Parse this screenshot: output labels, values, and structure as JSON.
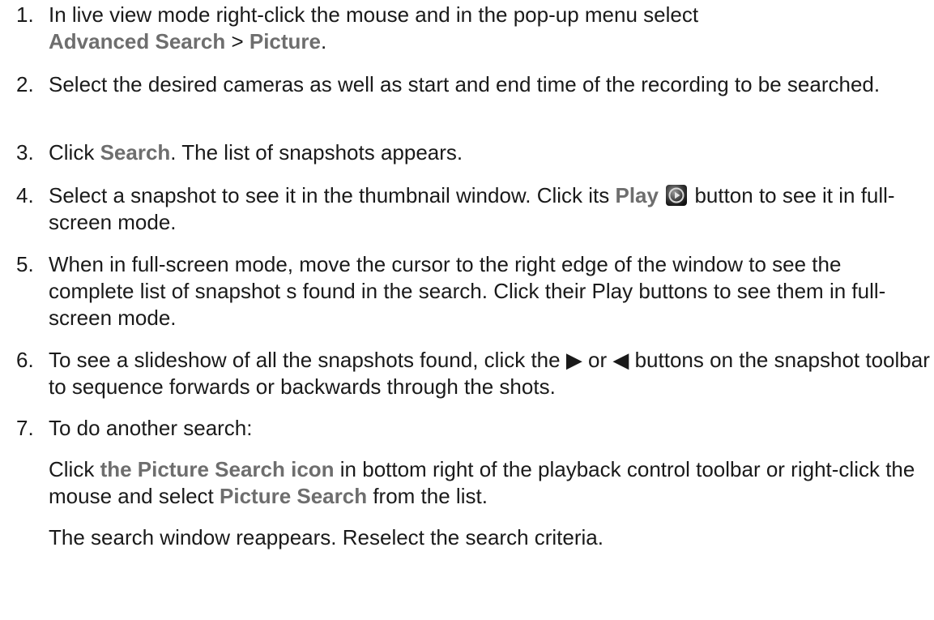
{
  "steps": [
    {
      "num": "1.",
      "t1": "In live view mode right-click the mouse and in the pop-up menu select",
      "ui1": "Advanced Search",
      "t2": " > ",
      "ui2": "Picture",
      "t3": "."
    },
    {
      "num": "2.",
      "t1": "Select the desired cameras as well as start and end time of the recording to be searched."
    },
    {
      "num": "3.",
      "t1": "Click ",
      "ui1": "Search",
      "t2": ". The list of snapshots appears."
    },
    {
      "num": "4.",
      "t1": "Select a snapshot to see it in the thumbnail window. Click its ",
      "ui1": "Play",
      "icon": "play-circle-icon",
      "t2": " button to see it in full-screen mode."
    },
    {
      "num": "5.",
      "t1": "When in full-screen mode, move the cursor to the right edge of the window to see the complete list of snapshot s found in the search. Click their Play buttons to see them in full-screen mode."
    },
    {
      "num": "6.",
      "t1": "To see a slideshow of all the snapshots found, click the ▶ or ◀ buttons on the snapshot toolbar to sequence forwards or backwards through the shots."
    },
    {
      "num": "7.",
      "t1": "To do another search:"
    }
  ],
  "sub": {
    "p1_t1": "Click ",
    "p1_ui1": "the Picture Search icon",
    "p1_t2": " in bottom right of the playback control toolbar or right-click the mouse and select ",
    "p1_ui2": "Picture Search",
    "p1_t3": " from the list.",
    "p2": "The search window reappears. Reselect the search criteria."
  },
  "colors": {
    "text": "#1a1a1a",
    "ui_term": "#6e6e6e"
  }
}
